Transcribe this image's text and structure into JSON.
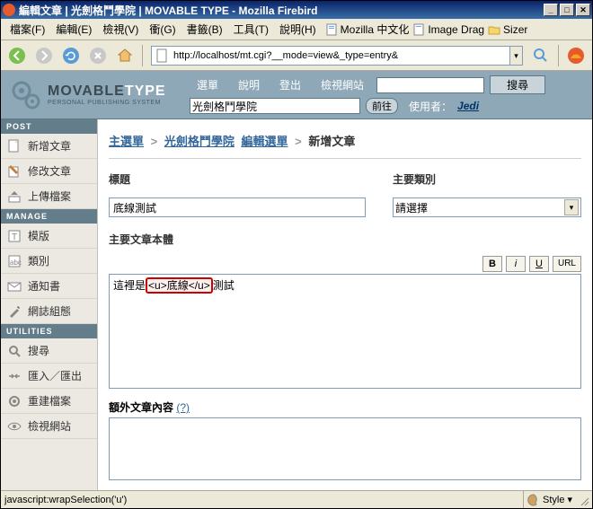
{
  "window": {
    "title": "編輯文章 | 光劍格鬥學院 | MOVABLE TYPE - Mozilla Firebird"
  },
  "menu": {
    "file": "檔案(F)",
    "edit": "編輯(E)",
    "view": "檢視(V)",
    "go": "衝(G)",
    "bookmarks": "書籤(B)",
    "tools": "工具(T)",
    "help": "說明(H)",
    "bm_mozilla": "Mozilla 中文化",
    "bm_imagedrag": "Image Drag",
    "bm_sizer": "Sizer"
  },
  "url": "http://localhost/mt.cgi?__mode=view&_type=entry&",
  "logo": {
    "brand_a": "MOVABLE",
    "brand_b": "TYPE",
    "sub": "PERSONAL PUBLISHING SYSTEM"
  },
  "header": {
    "menu": "選單",
    "help": "說明",
    "logout": "登出",
    "viewsite": "檢視網站",
    "search_btn": "搜尋",
    "blog_selected": "光劍格鬥學院",
    "go_btn": "前往",
    "user_label": "使用者：",
    "user_name": "Jedi"
  },
  "sidebar": {
    "section_post": "POST",
    "section_manage": "MANAGE",
    "section_utilities": "UTILITIES",
    "items": {
      "new_entry": "新增文章",
      "edit_entry": "修改文章",
      "upload": "上傳檔案",
      "templates": "模版",
      "categories": "類別",
      "notifications": "通知書",
      "blog_config": "網誌組態",
      "search": "搜尋",
      "import": "匯入／匯出",
      "rebuild": "重建檔案",
      "view_site": "檢視網站"
    }
  },
  "breadcrumb": {
    "main_menu": "主選單",
    "blog": "光劍格鬥學院",
    "edit_menu": "編輯選單",
    "current": "新增文章"
  },
  "form": {
    "title_label": "標題",
    "title_value": "底線測試",
    "category_label": "主要類別",
    "category_placeholder": "請選擇",
    "body_label": "主要文章本體",
    "body_pre": "這裡是",
    "body_tag": "<u>底線</u>",
    "body_post": "測試",
    "extra_label": "額外文章內容",
    "extra_q": "(?)",
    "btn_b": "B",
    "btn_i": "i",
    "btn_u": "U",
    "btn_url": "URL"
  },
  "status": {
    "text": "javascript:wrapSelection('u')",
    "style": "Style"
  }
}
